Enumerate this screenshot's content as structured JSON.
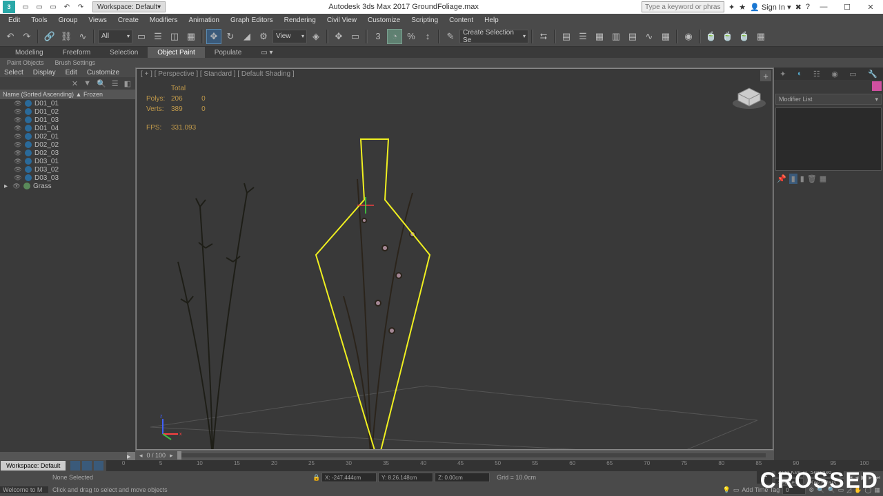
{
  "titlebar": {
    "workspace": "Workspace: Default",
    "title": "Autodesk 3ds Max 2017   GroundFoliage.max",
    "search_ph": "Type a keyword or phrase",
    "signin": "Sign In"
  },
  "menus": [
    "Edit",
    "Tools",
    "Group",
    "Views",
    "Create",
    "Modifiers",
    "Animation",
    "Graph Editors",
    "Rendering",
    "Civil View",
    "Customize",
    "Scripting",
    "Content",
    "Help"
  ],
  "toolbar": {
    "all": "All",
    "view": "View",
    "sel_set": "Create Selection Se"
  },
  "ribbon": {
    "tabs": [
      "Modeling",
      "Freeform",
      "Selection",
      "Object Paint",
      "Populate"
    ],
    "active": "Object Paint",
    "sub": [
      "Paint Objects",
      "Brush Settings"
    ]
  },
  "scene": {
    "top": [
      "Select",
      "Display",
      "Edit",
      "Customize"
    ],
    "header": "Name (Sorted Ascending)   ▲  Frozen",
    "items": [
      "D01_01",
      "D01_02",
      "D01_03",
      "D01_04",
      "D02_01",
      "D02_02",
      "D02_03",
      "D03_01",
      "D03_02",
      "D03_03",
      "Grass"
    ]
  },
  "viewport": {
    "label": "[ + ] [ Perspective ] [ Standard ] [ Default Shading ]",
    "stats": {
      "h_total": "Total",
      "polys_l": "Polys:",
      "polys_v": "206",
      "polys_t": "0",
      "verts_l": "Verts:",
      "verts_v": "389",
      "verts_t": "0",
      "fps_l": "FPS:",
      "fps_v": "331.093"
    },
    "slider": "0 / 100"
  },
  "modpanel": {
    "list": "Modifier List"
  },
  "status": {
    "ws": "Workspace: Default",
    "ruler": [
      "0",
      "5",
      "10",
      "15",
      "20",
      "25",
      "30",
      "35",
      "40",
      "45",
      "50",
      "55",
      "60",
      "65",
      "70",
      "75",
      "80",
      "85",
      "90",
      "95",
      "100"
    ],
    "none": "None Selected",
    "x": "X: -247.444cm",
    "y": "Y: 8.26.148cm",
    "z": "Z: 0.00cm",
    "grid": "Grid = 10.0cm",
    "welcome": "Welcome to M",
    "hint": "Click and drag to select and move objects",
    "addtime": "Add Time Tag",
    "autokey": "Auto Key",
    "selected": "Selected",
    "setkey": "Set Key",
    "keyf": "Key Filters..."
  },
  "overlay": "CROSSED"
}
